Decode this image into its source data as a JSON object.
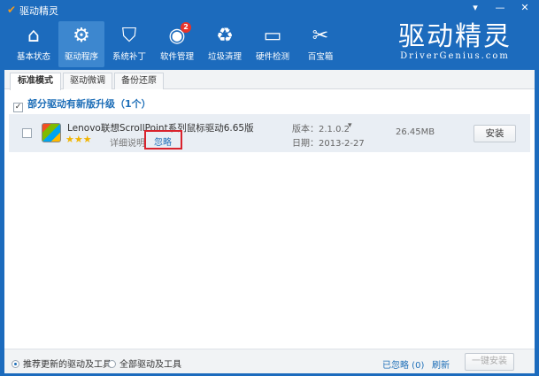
{
  "app": {
    "title": "驱动精灵"
  },
  "toolbar": {
    "items": [
      {
        "label": "基本状态",
        "icon": "home-icon"
      },
      {
        "label": "驱动程序",
        "icon": "gear-icon",
        "active": true
      },
      {
        "label": "系统补丁",
        "icon": "shield-icon"
      },
      {
        "label": "软件管理",
        "icon": "disc-icon",
        "badge": "2"
      },
      {
        "label": "垃圾清理",
        "icon": "recycle-bin-icon"
      },
      {
        "label": "硬件检测",
        "icon": "monitor-icon"
      },
      {
        "label": "百宝箱",
        "icon": "tools-icon"
      }
    ]
  },
  "brand": {
    "name": "驱动精灵",
    "site": "DriverGenius.com"
  },
  "tabs": [
    "标准模式",
    "驱动微调",
    "备份还原"
  ],
  "group": {
    "label": "部分驱动有新版升级（1个）"
  },
  "driver": {
    "name": "Lenovo联想ScrollPoint系列鼠标驱动6.65版",
    "rating": 3,
    "stars": "★★★",
    "details": "详细说明",
    "ignore": "忽略",
    "version": "版本：2.1.0.2",
    "date": "日期：2013-2-27",
    "size": "26.45MB",
    "install": "安装"
  },
  "footer": {
    "option1": "推荐更新的驱动及工具",
    "option2": "全部驱动及工具",
    "ignored": "已忽略 (0)",
    "refresh": "刷新",
    "install_all": "一键安装"
  },
  "colors": {
    "accent": "#1c6bbd",
    "highlight": "#d9232d"
  }
}
